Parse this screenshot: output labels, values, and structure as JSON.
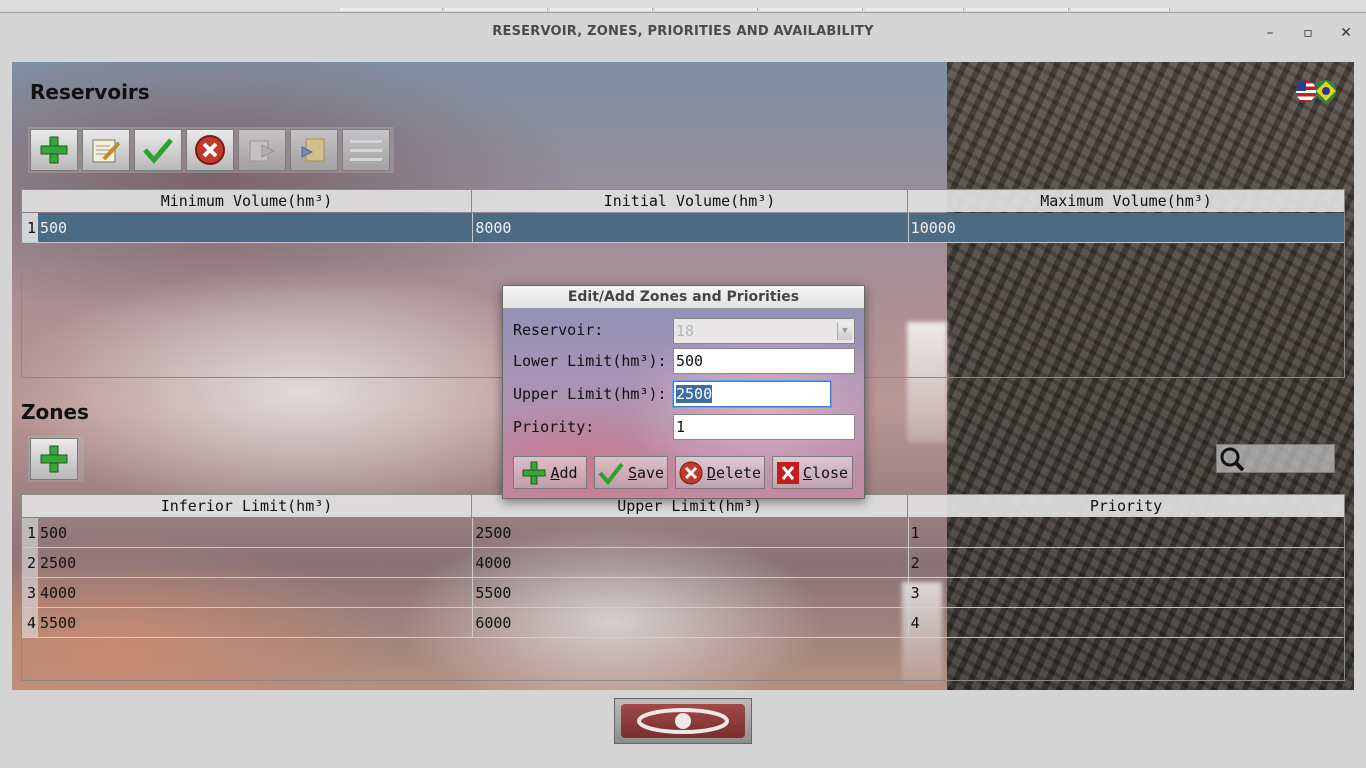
{
  "window": {
    "title": "RESERVOIR, ZONES, PRIORITIES AND AVAILABILITY",
    "minimize": "–",
    "maximize": "▫",
    "close": "✕"
  },
  "reservoirs": {
    "title": "Reservoirs",
    "toolbar": [
      "add-icon",
      "edit-icon",
      "confirm-icon",
      "cancel-icon",
      "export-icon",
      "import-icon",
      "menu-icon"
    ],
    "columns": [
      "Minimum Volume(hm³)",
      "Initial Volume(hm³)",
      "Maximum Volume(hm³)"
    ],
    "rows": [
      {
        "n": "1",
        "cells": [
          "500",
          "8000",
          "10000"
        ]
      }
    ]
  },
  "zones": {
    "title": "Zones",
    "columns": [
      "Inferior Limit(hm³)",
      "Upper Limit(hm³)",
      "Priority"
    ],
    "rows": [
      {
        "n": "1",
        "cells": [
          "500",
          "2500",
          "1"
        ]
      },
      {
        "n": "2",
        "cells": [
          "2500",
          "4000",
          "2"
        ]
      },
      {
        "n": "3",
        "cells": [
          "4000",
          "5500",
          "3"
        ]
      },
      {
        "n": "4",
        "cells": [
          "5500",
          "6000",
          "4"
        ]
      }
    ],
    "search_placeholder": ""
  },
  "dialog": {
    "title": "Edit/Add Zones and Priorities",
    "reservoir_label": "Reservoir:",
    "reservoir_value": "18",
    "lower_label": "Lower Limit(hm³):",
    "lower_value": "500",
    "upper_label": "Upper Limit(hm³):",
    "upper_value": "2500",
    "priority_label": "Priority:",
    "priority_value": "1",
    "buttons": {
      "add_u": "A",
      "add_rest": "dd",
      "save_u": "S",
      "save_rest": "ave",
      "delete_u": "D",
      "delete_rest": "elete",
      "close_u": "C",
      "close_rest": "lose"
    }
  },
  "colors": {
    "selected_row": "#4b6a84",
    "close_red": "#c0392b"
  }
}
